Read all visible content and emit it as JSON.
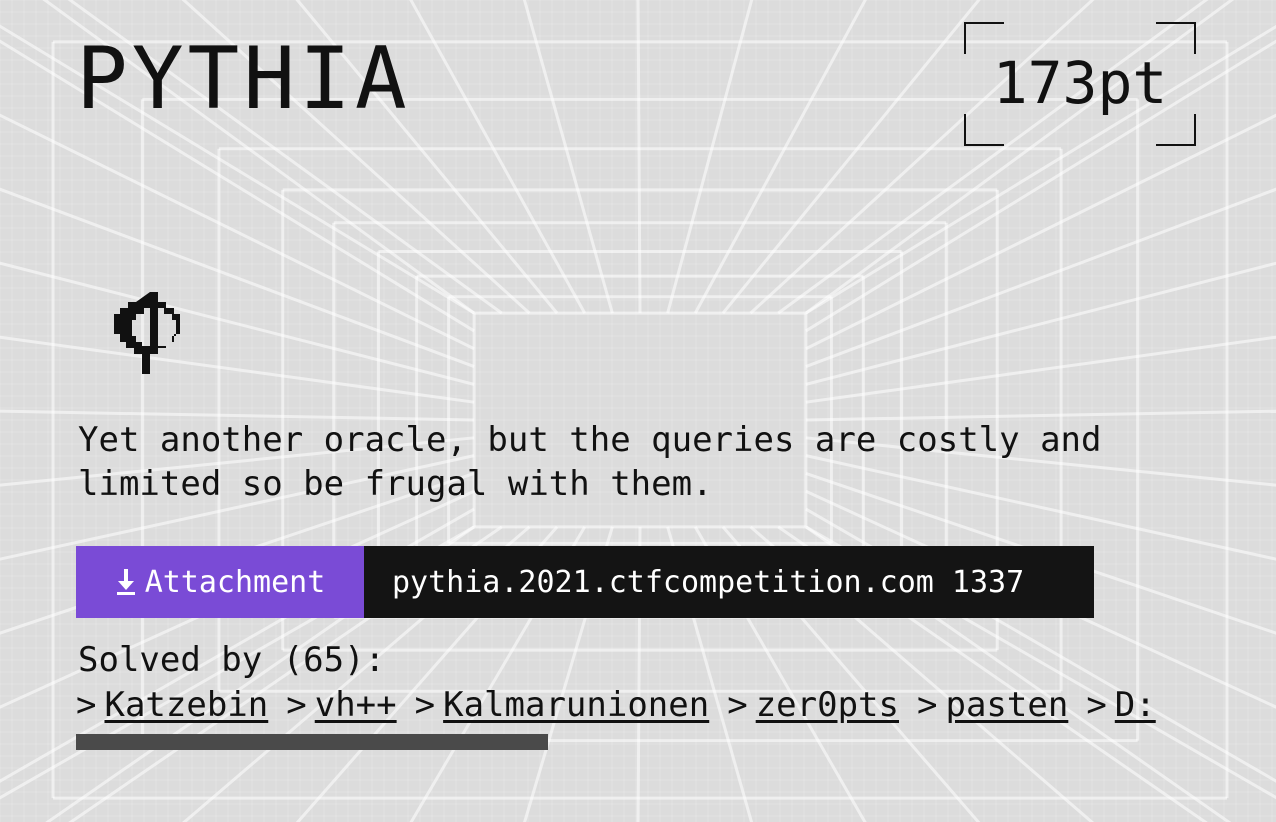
{
  "challenge": {
    "title": "PYTHIA",
    "points": "173pt",
    "icon": "psi-glyph-icon",
    "description": "Yet another oracle, but the queries are costly and limited so be frugal with them."
  },
  "attachment": {
    "label": "Attachment",
    "icon": "download-arrow-icon",
    "host": "pythia.2021.ctfcompetition.com 1337"
  },
  "solved": {
    "label": "Solved by (65):",
    "separator": ">",
    "teams": [
      "Katzebin",
      "vh++",
      "Kalmarunionen",
      "zer0pts",
      "pasten",
      "D:"
    ]
  },
  "colors": {
    "background": "#dcdcdc",
    "accent": "#7a4bd6",
    "host_bg": "#141414",
    "scrollbar": "#4a4a4a"
  }
}
